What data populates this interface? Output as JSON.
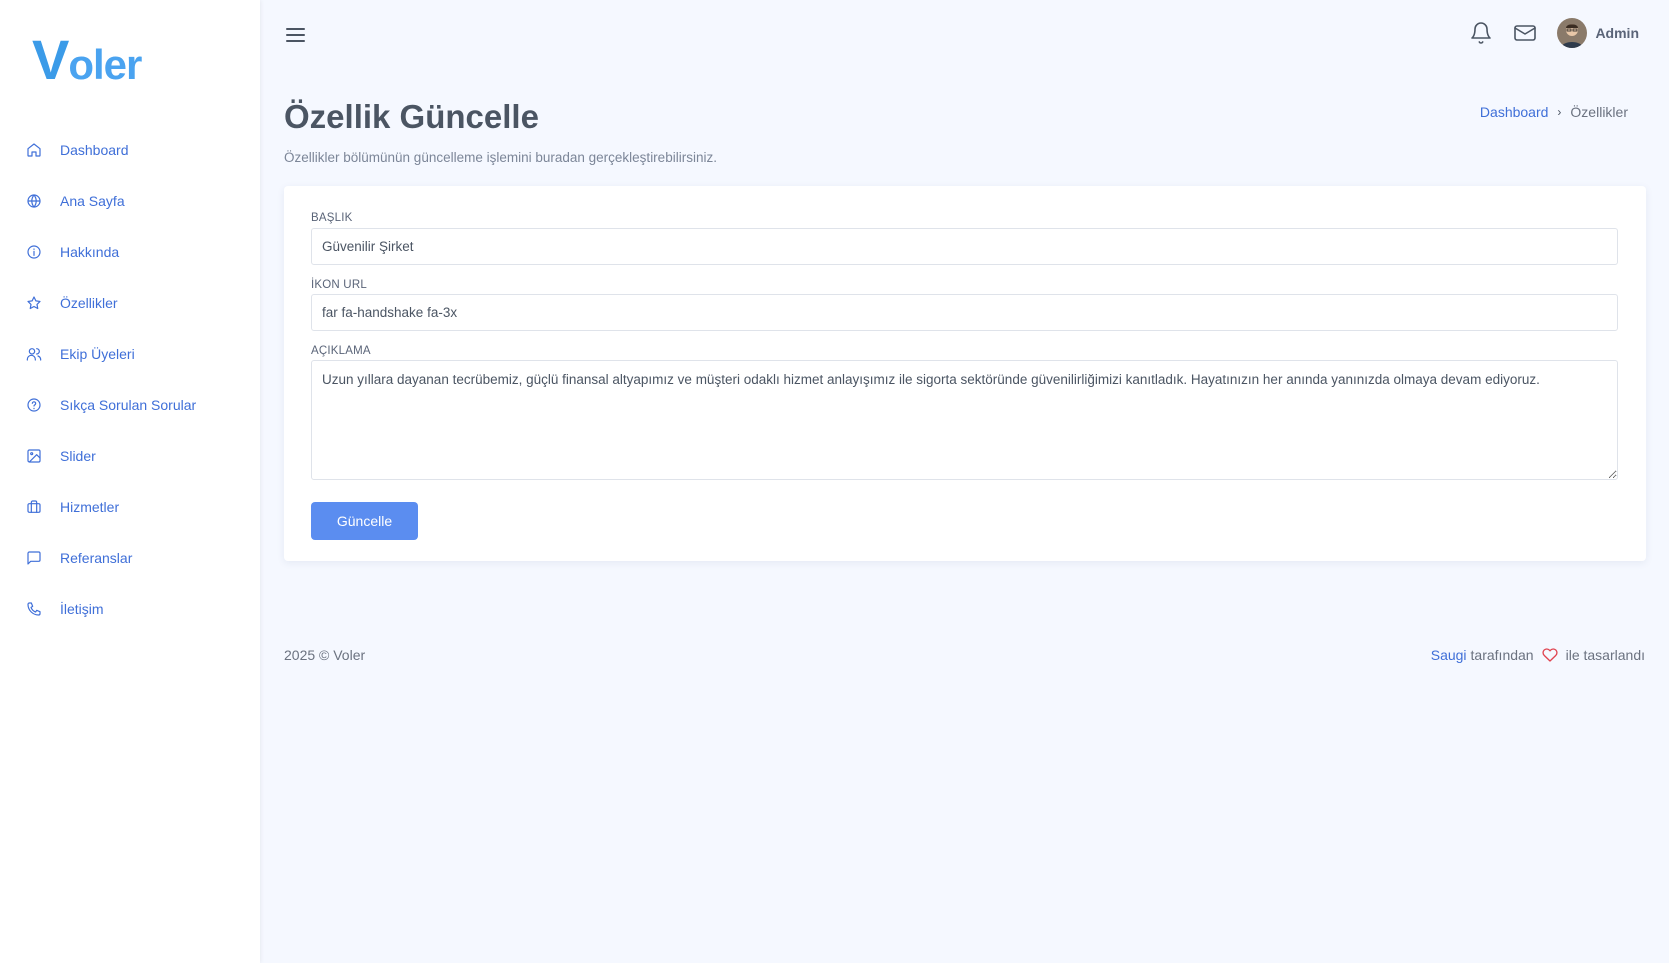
{
  "brand": {
    "logo_first": "V",
    "logo_rest": "oler"
  },
  "sidebar": {
    "items": [
      {
        "label": "Dashboard",
        "icon": "home-icon"
      },
      {
        "label": "Ana Sayfa",
        "icon": "globe-icon"
      },
      {
        "label": "Hakkında",
        "icon": "info-icon"
      },
      {
        "label": "Özellikler",
        "icon": "star-icon"
      },
      {
        "label": "Ekip Üyeleri",
        "icon": "users-icon"
      },
      {
        "label": "Sıkça Sorulan Sorular",
        "icon": "help-circle-icon"
      },
      {
        "label": "Slider",
        "icon": "image-icon"
      },
      {
        "label": "Hizmetler",
        "icon": "briefcase-icon"
      },
      {
        "label": "Referanslar",
        "icon": "message-square-icon"
      },
      {
        "label": "İletişim",
        "icon": "phone-icon"
      }
    ]
  },
  "topbar": {
    "user_name": "Admin"
  },
  "page": {
    "title": "Özellik Güncelle",
    "subtitle": "Özellikler bölümünün güncelleme işlemini buradan gerçekleştirebilirsiniz."
  },
  "breadcrumb": {
    "link": "Dashboard",
    "current": "Özellikler"
  },
  "form": {
    "title_label": "BAŞLIK",
    "title_value": "Güvenilir Şirket",
    "icon_label": "İKON URL",
    "icon_value": "far fa-handshake fa-3x",
    "desc_label": "AÇIKLAMA",
    "desc_value": "Uzun yıllara dayanan tecrübemiz, güçlü finansal altyapımız ve müşteri odaklı hizmet anlayışımız ile sigorta sektöründe güvenilirliğimizi kanıtladık. Hayatınızın her anında yanınızda olmaya devam ediyoruz.",
    "submit_label": "Güncelle"
  },
  "footer": {
    "copyright": "2025 © Voler",
    "author": "Saugi",
    "by_text": "tarafından",
    "designed_text": "ile tasarlandı"
  }
}
